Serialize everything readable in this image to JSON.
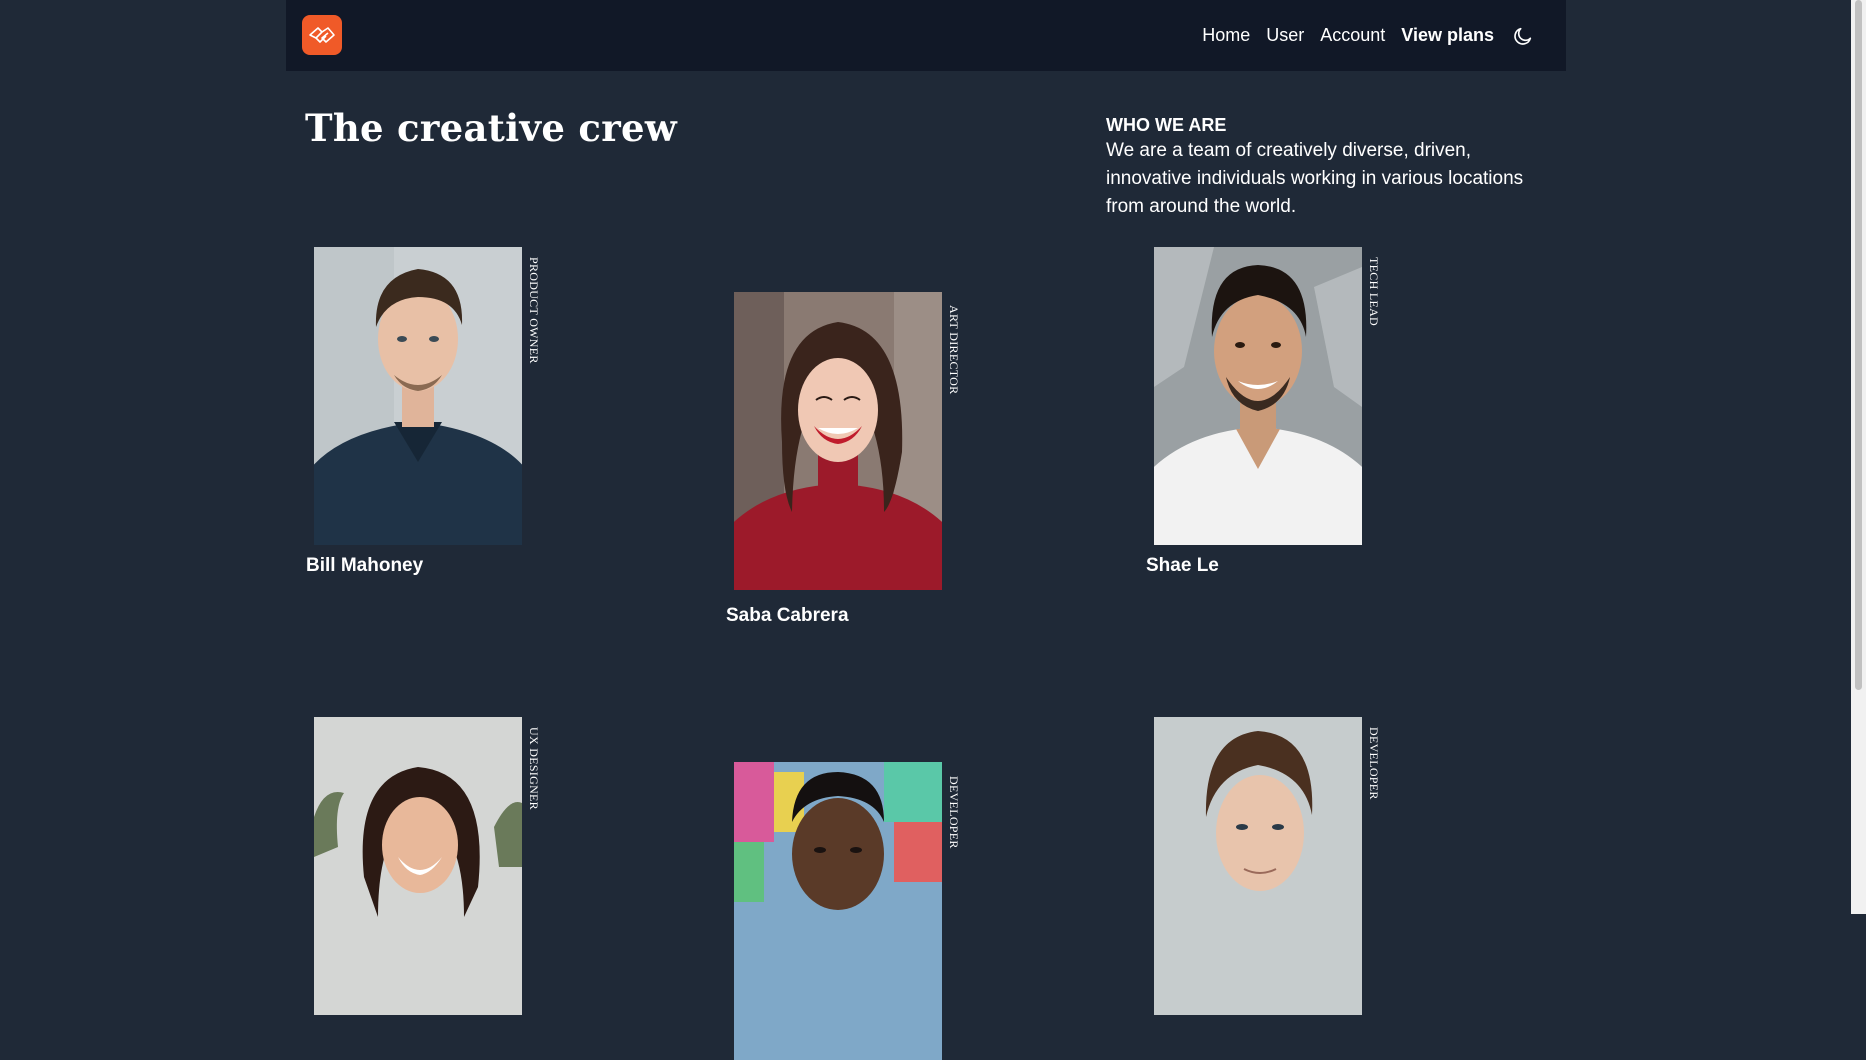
{
  "nav": {
    "logo": "logo",
    "links": [
      "Home",
      "User",
      "Account",
      "View plans"
    ],
    "theme_toggle_icon": "moon-icon"
  },
  "hero": {
    "title": "The creative crew",
    "who_heading": "WHO WE ARE",
    "who_text": "We are a team of creatively diverse, driven, innovative individuals working in various locations from around the world."
  },
  "team": [
    {
      "name": "Bill Mahoney",
      "role": "PRODUCT OWNER"
    },
    {
      "name": "Saba Cabrera",
      "role": "ART DIRECTOR"
    },
    {
      "name": "Shae Le",
      "role": "TECH LEAD"
    },
    {
      "name": "",
      "role": "UX DESIGNER"
    },
    {
      "name": "",
      "role": "DEVELOPER"
    },
    {
      "name": "",
      "role": "DEVELOPER"
    }
  ],
  "colors": {
    "background": "#1f2937",
    "navbar": "#111827",
    "logo_accent": "#f05a28",
    "text": "#ffffff"
  }
}
